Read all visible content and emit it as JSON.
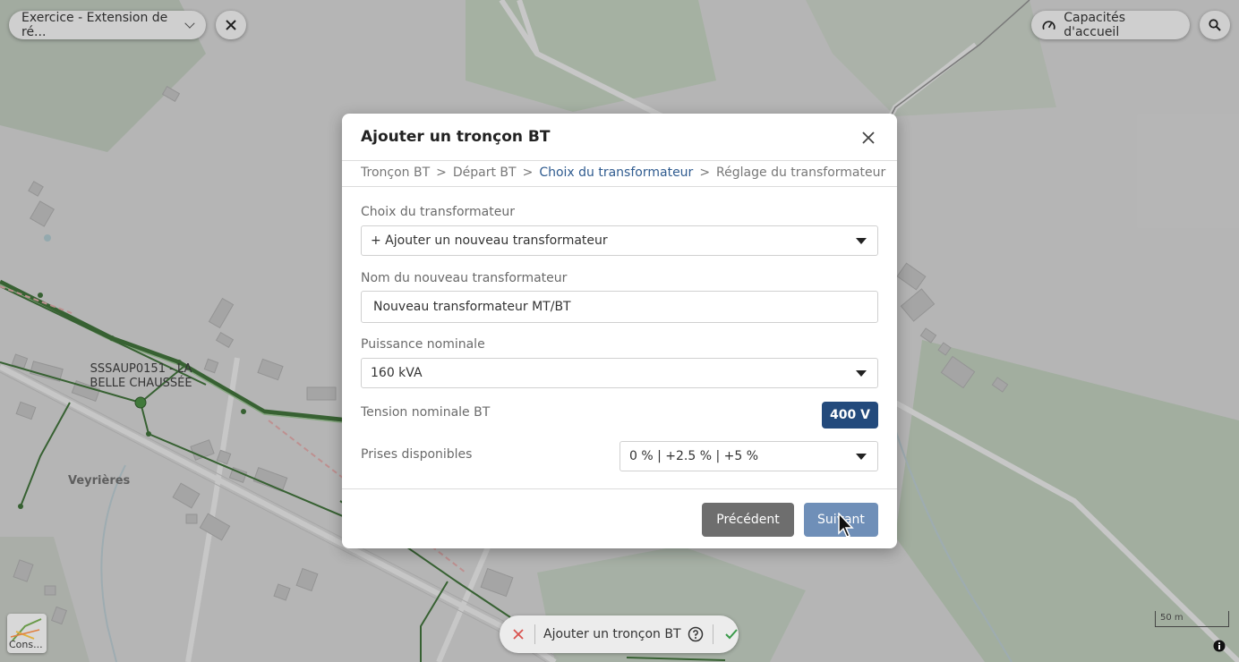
{
  "project_select": {
    "label": "Exercice - Extension de ré..."
  },
  "capacity_button": {
    "label": "Capacités d'accueil"
  },
  "map": {
    "substation_label": "SSSAUP0151 - LA BELLE CHAUSSÉE",
    "place_label": "Veyrières",
    "layer_thumb_label": "Cons...",
    "scale_label": "50 m"
  },
  "modal": {
    "title": "Ajouter un tronçon BT",
    "breadcrumb": [
      {
        "label": "Tronçon BT"
      },
      {
        "label": "Départ BT"
      },
      {
        "label": "Choix du transformateur"
      },
      {
        "label": "Réglage du transformateur"
      }
    ],
    "breadcrumb_separator": ">",
    "transformer_choice": {
      "label": "Choix du transformateur",
      "value": "+ Ajouter un nouveau transformateur"
    },
    "transformer_name": {
      "label": "Nom du nouveau transformateur",
      "value": "Nouveau transformateur MT/BT"
    },
    "nominal_power": {
      "label": "Puissance nominale",
      "value": "160 kVA"
    },
    "nominal_voltage": {
      "label": "Tension nominale BT",
      "value": "400 V"
    },
    "available_taps": {
      "label": "Prises disponibles",
      "value": "0 % | +2.5 % | +5 %"
    },
    "previous_label": "Précédent",
    "next_label": "Suivant"
  },
  "bottom_bar": {
    "label": "Ajouter un tronçon BT"
  },
  "colors": {
    "accent": "#2f5b8f",
    "badge": "#234a7c",
    "next_button": "#6f8fb8",
    "prev_button": "#6e6e6e",
    "network_line": "#3f6f3a",
    "cancel_icon": "#d9534f",
    "confirm_icon": "#3a9a4a"
  }
}
